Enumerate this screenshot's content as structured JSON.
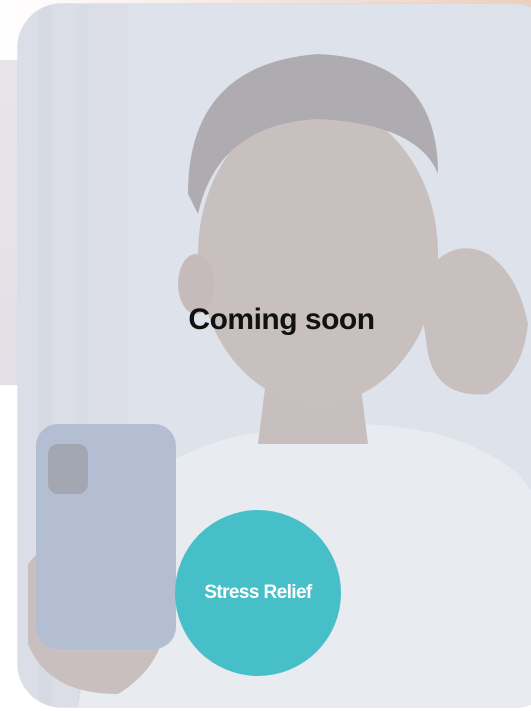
{
  "status": {
    "coming_soon": "Coming soon"
  },
  "category": {
    "label": "Stress Relief",
    "color": "#47bfc9"
  },
  "colors": {
    "overlay": "#eceff4",
    "title_text": "#111111",
    "button_text": "#ffffff"
  },
  "icons": {
    "photo": "person-with-phone-photo"
  }
}
